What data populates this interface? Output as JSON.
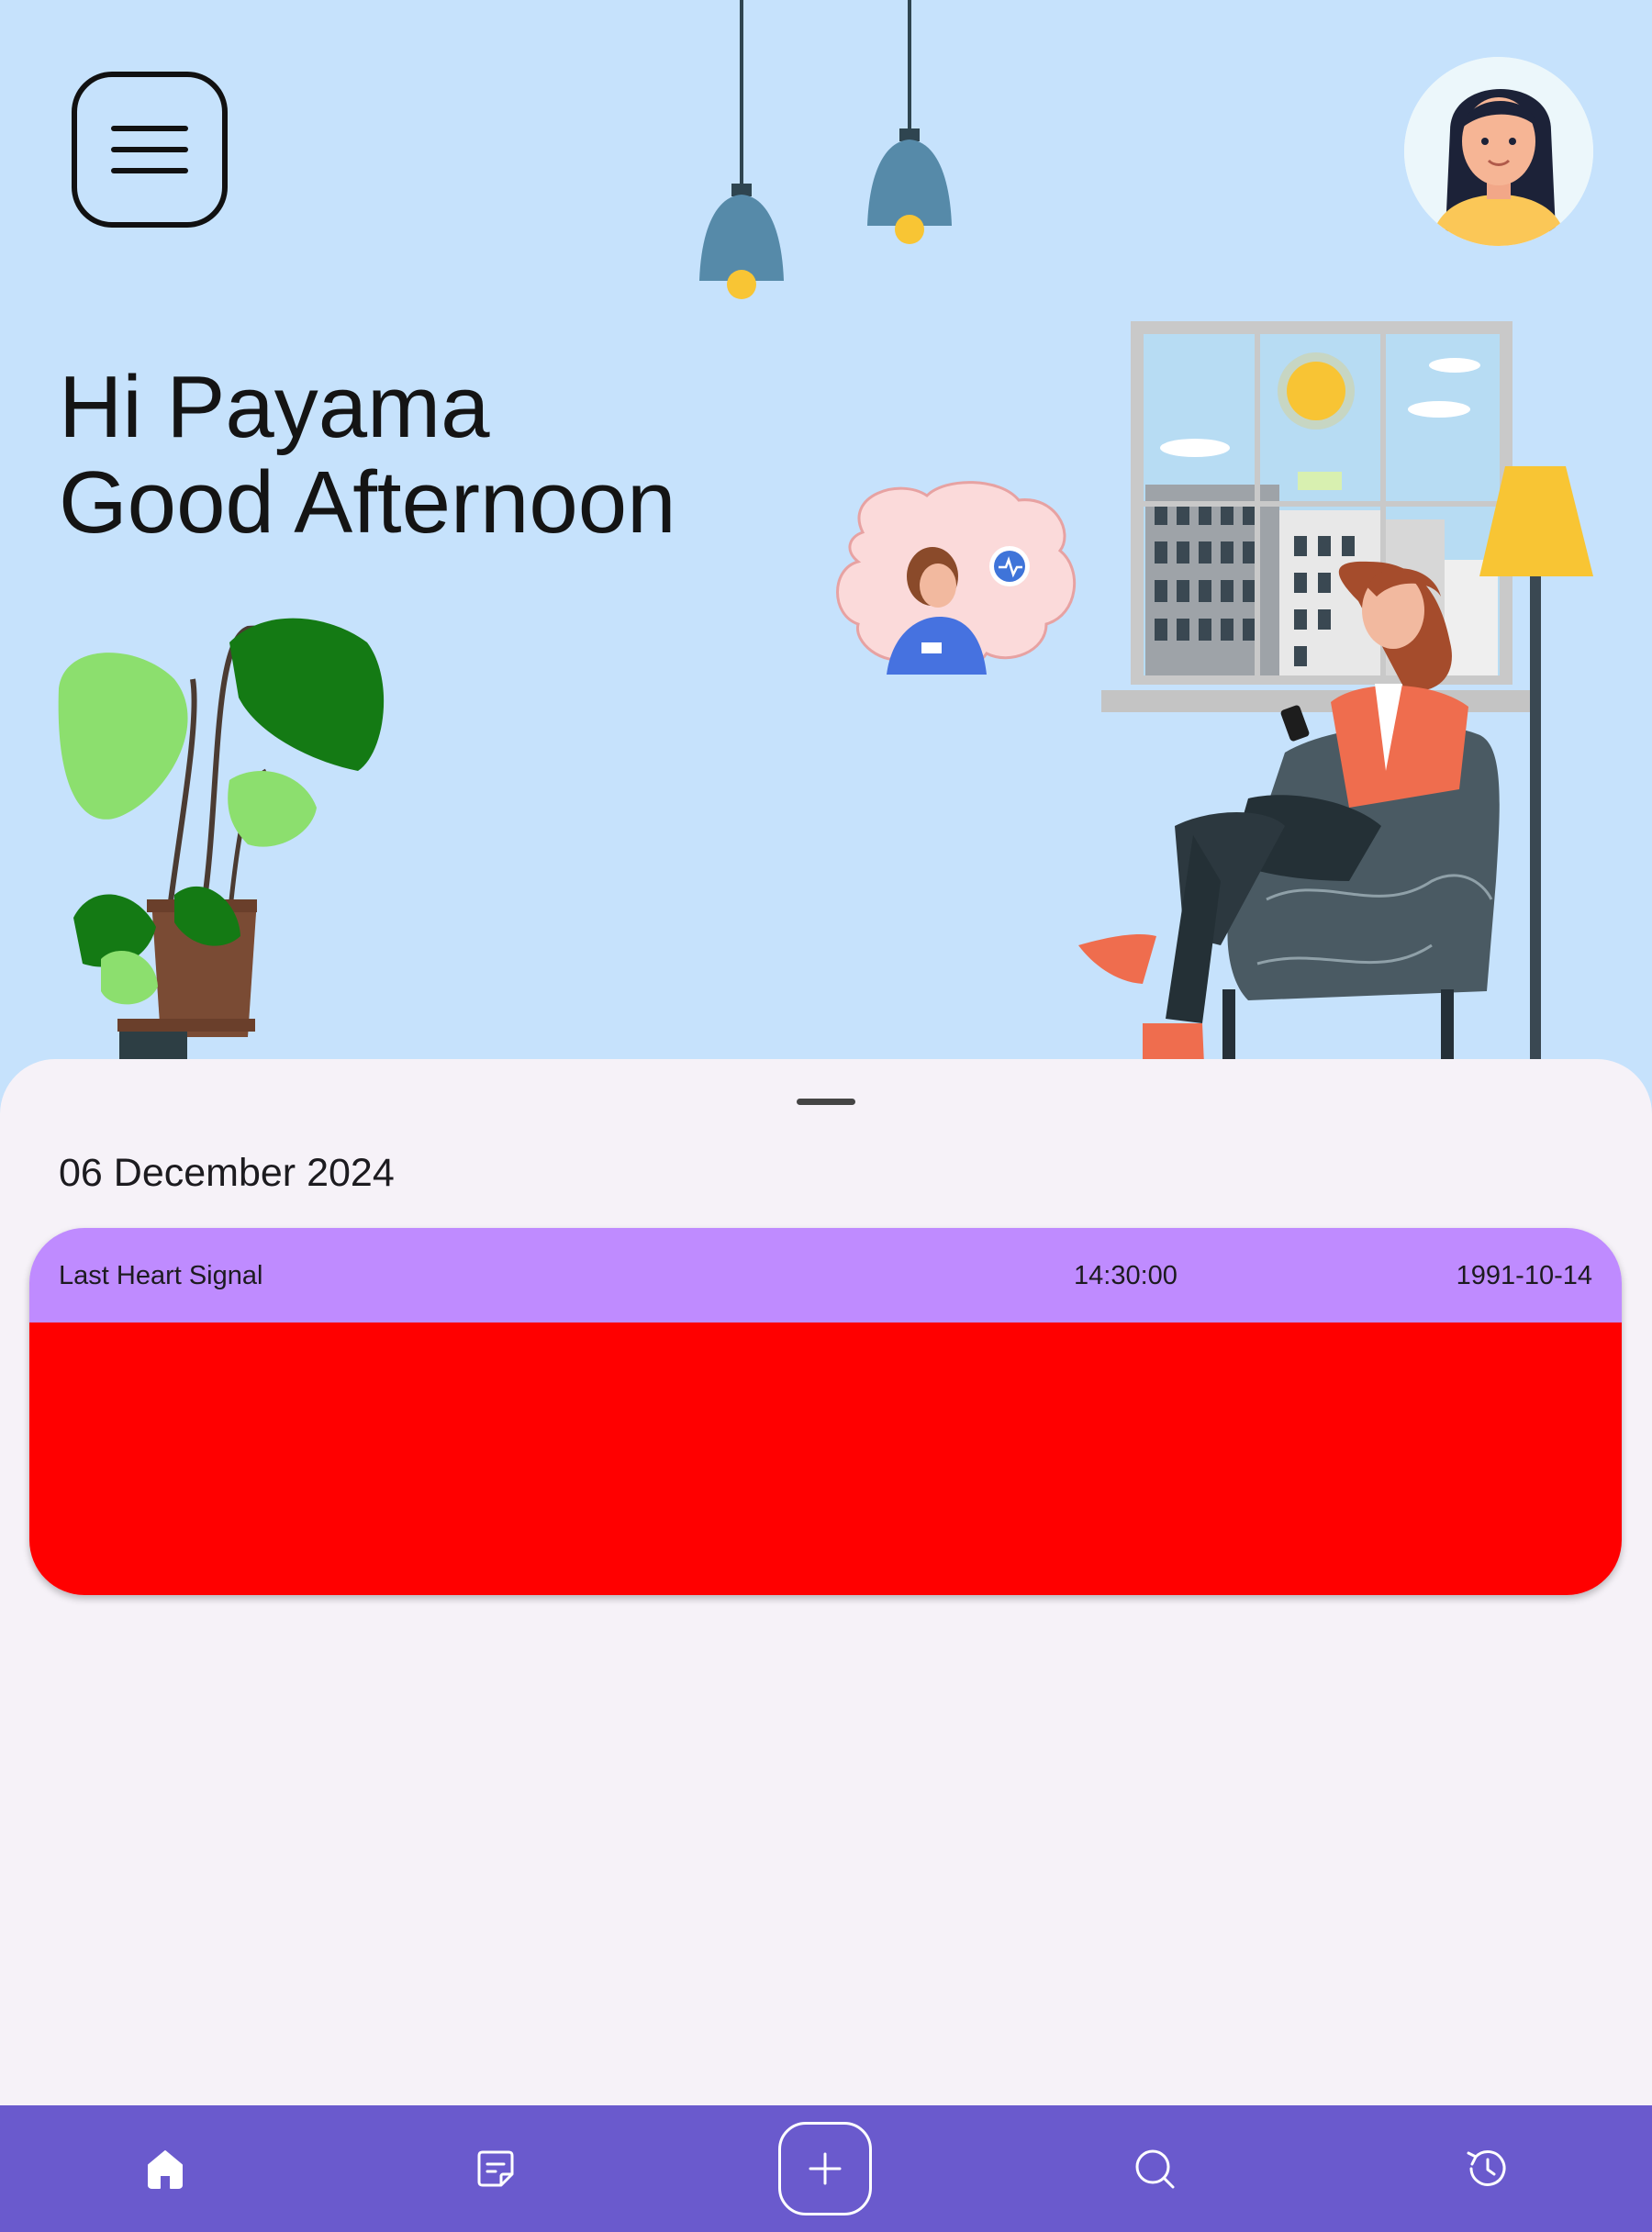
{
  "header": {
    "menu_icon": "hamburger-menu-icon",
    "avatar_icon": "user-avatar"
  },
  "greeting": {
    "line1": "Hi Payama",
    "line2": "Good Afternoon"
  },
  "illustration": "living-room-telehealth-illustration",
  "sheet": {
    "date": "06 December 2024",
    "card": {
      "title": "Last Heart Signal",
      "time": "14:30:00",
      "date": "1991-10-14",
      "header_color": "#bf8bff",
      "body_color": "#ff0000"
    }
  },
  "nav": {
    "background": "#6a5acd",
    "items": [
      "home-icon",
      "note-icon",
      "add-icon",
      "search-icon",
      "history-icon"
    ]
  }
}
